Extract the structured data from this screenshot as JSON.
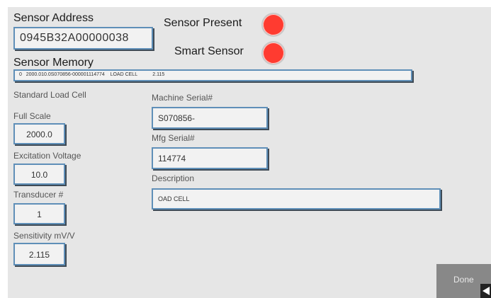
{
  "header": {
    "sensor_address_label": "Sensor Address",
    "sensor_address_value": "0945B32A00000038",
    "sensor_present_label": "Sensor Present",
    "smart_sensor_label": "Smart Sensor",
    "sensor_memory_label": "Sensor Memory",
    "sensor_memory_value": "0   2000.010.0S070856-000001114774    LOAD CELL           2.115"
  },
  "indicators": {
    "sensor_present_color": "#ff3b30",
    "smart_sensor_color": "#ff3b30"
  },
  "left": {
    "type_label": "Standard Load Cell",
    "full_scale_label": "Full Scale",
    "full_scale_value": "2000.0",
    "excitation_label": "Excitation Voltage",
    "excitation_value": "10.0",
    "transducer_label": "Transducer #",
    "transducer_value": "1",
    "sensitivity_label": "Sensitivity mV/V",
    "sensitivity_value": "2.115"
  },
  "right": {
    "machine_serial_label": "Machine Serial#",
    "machine_serial_value": "S070856-",
    "mfg_serial_label": "Mfg Serial#",
    "mfg_serial_value": "114774",
    "description_label": "Description",
    "description_value": "OAD CELL"
  },
  "actions": {
    "done_label": "Done"
  },
  "colors": {
    "panel_bg": "#e6e6e6",
    "field_border": "#5f8fb8",
    "done_bg": "#888888"
  }
}
